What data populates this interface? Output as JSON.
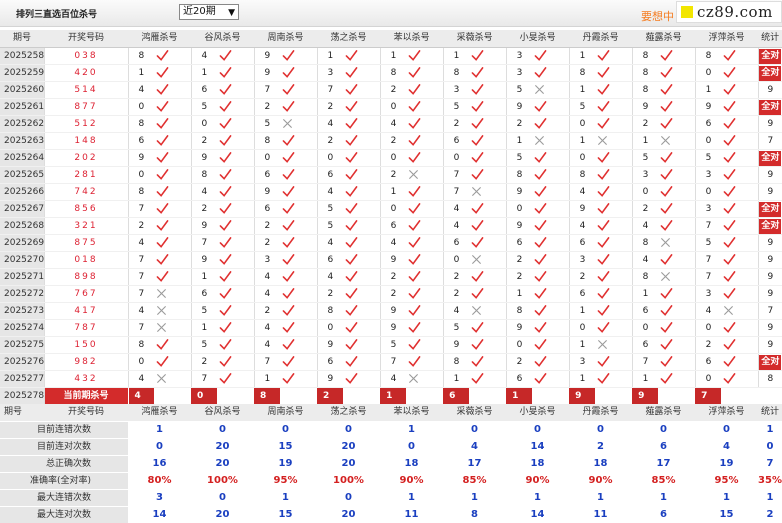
{
  "header": {
    "title": "排列三直选百位杀号",
    "period_select": "近20期",
    "promo": "要想中",
    "brand": "cz89.com"
  },
  "columns": {
    "period": "期号",
    "draw": "开奖号码",
    "stat": "统计",
    "experts": [
      "鸿雁杀号",
      "谷风杀号",
      "周南杀号",
      "荡之杀号",
      "苯以杀号",
      "采薇杀号",
      "小旻杀号",
      "丹霞杀号",
      "薤露杀号",
      "浮萍杀号"
    ]
  },
  "rows": [
    {
      "period": "2025258",
      "draw": "038",
      "kills": [
        8,
        4,
        9,
        1,
        1,
        1,
        3,
        1,
        8,
        8
      ],
      "ok": [
        1,
        1,
        1,
        1,
        1,
        1,
        1,
        1,
        1,
        1
      ],
      "stat": "全对"
    },
    {
      "period": "2025259",
      "draw": "420",
      "kills": [
        1,
        1,
        9,
        3,
        8,
        8,
        3,
        8,
        8,
        0
      ],
      "ok": [
        1,
        1,
        1,
        1,
        1,
        1,
        1,
        1,
        1,
        1
      ],
      "stat": "全对"
    },
    {
      "period": "2025260",
      "draw": "514",
      "kills": [
        4,
        6,
        7,
        7,
        2,
        3,
        5,
        1,
        8,
        1
      ],
      "ok": [
        1,
        1,
        1,
        1,
        1,
        1,
        0,
        1,
        1,
        1
      ],
      "stat": "9"
    },
    {
      "period": "2025261",
      "draw": "877",
      "kills": [
        0,
        5,
        2,
        2,
        0,
        5,
        9,
        5,
        9,
        9
      ],
      "ok": [
        1,
        1,
        1,
        1,
        1,
        1,
        1,
        1,
        1,
        1
      ],
      "stat": "全对"
    },
    {
      "period": "2025262",
      "draw": "512",
      "kills": [
        8,
        0,
        5,
        4,
        4,
        2,
        2,
        0,
        2,
        6
      ],
      "ok": [
        1,
        1,
        0,
        1,
        1,
        1,
        1,
        1,
        1,
        1
      ],
      "stat": "9"
    },
    {
      "period": "2025263",
      "draw": "148",
      "kills": [
        6,
        2,
        8,
        2,
        2,
        6,
        1,
        1,
        1,
        0
      ],
      "ok": [
        1,
        1,
        1,
        1,
        1,
        1,
        0,
        0,
        0,
        1
      ],
      "stat": "7"
    },
    {
      "period": "2025264",
      "draw": "202",
      "kills": [
        9,
        9,
        0,
        0,
        0,
        0,
        5,
        0,
        5,
        5
      ],
      "ok": [
        1,
        1,
        1,
        1,
        1,
        1,
        1,
        1,
        1,
        1
      ],
      "stat": "全对"
    },
    {
      "period": "2025265",
      "draw": "281",
      "kills": [
        0,
        8,
        6,
        6,
        2,
        7,
        8,
        8,
        3,
        3
      ],
      "ok": [
        1,
        1,
        1,
        1,
        0,
        1,
        1,
        1,
        1,
        1
      ],
      "stat": "9"
    },
    {
      "period": "2025266",
      "draw": "742",
      "kills": [
        8,
        4,
        9,
        4,
        1,
        7,
        9,
        4,
        0,
        0
      ],
      "ok": [
        1,
        1,
        1,
        1,
        1,
        0,
        1,
        1,
        1,
        1
      ],
      "stat": "9"
    },
    {
      "period": "2025267",
      "draw": "856",
      "kills": [
        7,
        2,
        6,
        5,
        0,
        4,
        0,
        9,
        2,
        3
      ],
      "ok": [
        1,
        1,
        1,
        1,
        1,
        1,
        1,
        1,
        1,
        1
      ],
      "stat": "全对"
    },
    {
      "period": "2025268",
      "draw": "321",
      "kills": [
        2,
        9,
        2,
        5,
        6,
        4,
        9,
        4,
        4,
        7
      ],
      "ok": [
        1,
        1,
        1,
        1,
        1,
        1,
        1,
        1,
        1,
        1
      ],
      "stat": "全对"
    },
    {
      "period": "2025269",
      "draw": "875",
      "kills": [
        4,
        7,
        2,
        4,
        4,
        6,
        6,
        6,
        8,
        5
      ],
      "ok": [
        1,
        1,
        1,
        1,
        1,
        1,
        1,
        1,
        0,
        1
      ],
      "stat": "9"
    },
    {
      "period": "2025270",
      "draw": "018",
      "kills": [
        7,
        9,
        3,
        6,
        9,
        0,
        2,
        3,
        4,
        7
      ],
      "ok": [
        1,
        1,
        1,
        1,
        1,
        0,
        1,
        1,
        1,
        1
      ],
      "stat": "9"
    },
    {
      "period": "2025271",
      "draw": "898",
      "kills": [
        7,
        1,
        4,
        4,
        2,
        2,
        2,
        2,
        8,
        7
      ],
      "ok": [
        1,
        1,
        1,
        1,
        1,
        1,
        1,
        1,
        0,
        1
      ],
      "stat": "9"
    },
    {
      "period": "2025272",
      "draw": "767",
      "kills": [
        7,
        6,
        4,
        2,
        2,
        2,
        1,
        6,
        1,
        3
      ],
      "ok": [
        0,
        1,
        1,
        1,
        1,
        1,
        1,
        1,
        1,
        1
      ],
      "stat": "9"
    },
    {
      "period": "2025273",
      "draw": "417",
      "kills": [
        4,
        5,
        2,
        8,
        9,
        4,
        8,
        1,
        6,
        4
      ],
      "ok": [
        0,
        1,
        1,
        1,
        1,
        0,
        1,
        1,
        1,
        0
      ],
      "stat": "7"
    },
    {
      "period": "2025274",
      "draw": "787",
      "kills": [
        7,
        1,
        4,
        0,
        9,
        5,
        9,
        0,
        0,
        0
      ],
      "ok": [
        0,
        1,
        1,
        1,
        1,
        1,
        1,
        1,
        1,
        1
      ],
      "stat": "9"
    },
    {
      "period": "2025275",
      "draw": "150",
      "kills": [
        8,
        5,
        4,
        9,
        5,
        9,
        0,
        1,
        6,
        2
      ],
      "ok": [
        1,
        1,
        1,
        1,
        1,
        1,
        1,
        0,
        1,
        1
      ],
      "stat": "9"
    },
    {
      "period": "2025276",
      "draw": "982",
      "kills": [
        0,
        2,
        7,
        6,
        7,
        8,
        2,
        3,
        7,
        6
      ],
      "ok": [
        1,
        1,
        1,
        1,
        1,
        1,
        1,
        1,
        1,
        1
      ],
      "stat": "全对"
    },
    {
      "period": "2025277",
      "draw": "432",
      "kills": [
        4,
        7,
        1,
        9,
        4,
        1,
        6,
        1,
        1,
        0
      ],
      "ok": [
        0,
        1,
        1,
        1,
        0,
        1,
        1,
        1,
        1,
        1
      ],
      "stat": "8"
    }
  ],
  "current": {
    "period": "2025278",
    "label": "当前期杀号",
    "kills": [
      "4",
      "0",
      "8",
      "2",
      "1",
      "6",
      "1",
      "9",
      "9",
      "7"
    ]
  },
  "stats": {
    "labels": [
      "目前连错次数",
      "目前连对次数",
      "总正确次数",
      "准确率(全对率)",
      "最大连错次数",
      "最大连对次数"
    ],
    "values": [
      [
        "1",
        "0",
        "0",
        "0",
        "1",
        "0",
        "0",
        "0",
        "0",
        "0",
        "1"
      ],
      [
        "0",
        "20",
        "15",
        "20",
        "0",
        "4",
        "14",
        "2",
        "6",
        "4",
        "0"
      ],
      [
        "16",
        "20",
        "19",
        "20",
        "18",
        "17",
        "18",
        "18",
        "17",
        "19",
        "7"
      ],
      [
        "80%",
        "100%",
        "95%",
        "100%",
        "90%",
        "85%",
        "90%",
        "90%",
        "85%",
        "95%",
        "35%"
      ],
      [
        "3",
        "0",
        "1",
        "0",
        "1",
        "1",
        "1",
        "1",
        "1",
        "1",
        "1"
      ],
      [
        "14",
        "20",
        "15",
        "20",
        "11",
        "8",
        "14",
        "11",
        "6",
        "15",
        "2"
      ]
    ]
  }
}
